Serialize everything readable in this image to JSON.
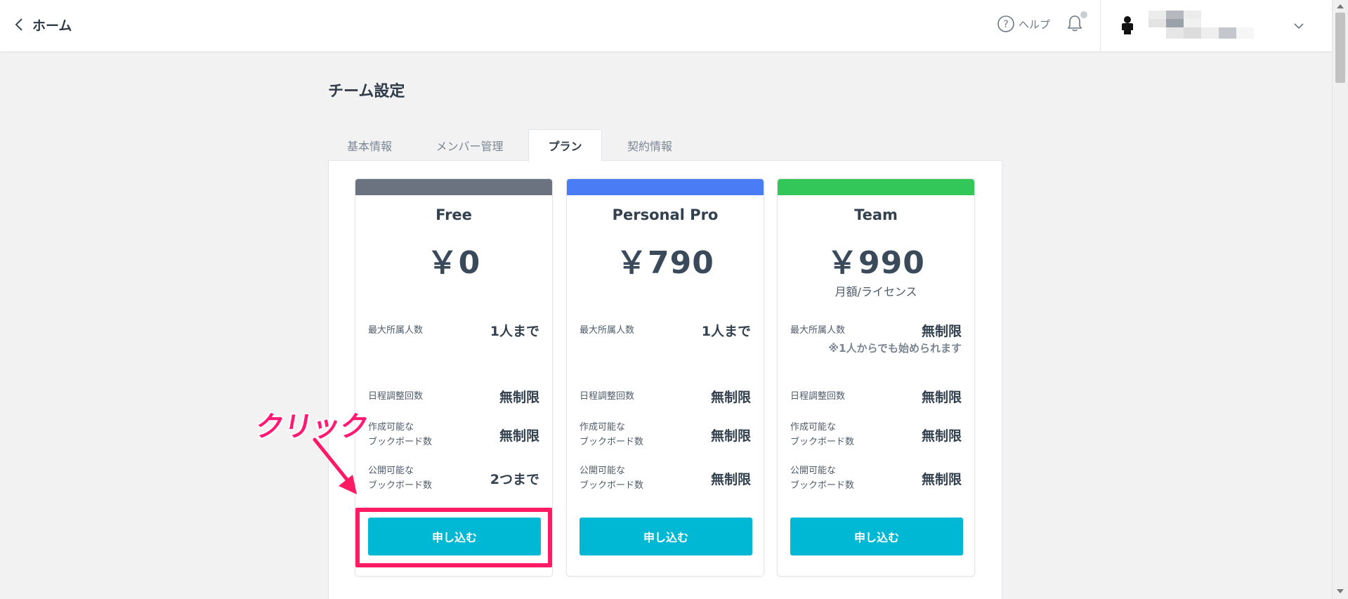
{
  "header": {
    "back_label": "ホーム",
    "help_label": "ヘルプ"
  },
  "page": {
    "title": "チーム設定",
    "tabs": [
      {
        "label": "基本情報",
        "active": false
      },
      {
        "label": "メンバー管理",
        "active": false
      },
      {
        "label": "プラン",
        "active": true
      },
      {
        "label": "契約情報",
        "active": false
      }
    ]
  },
  "plans": [
    {
      "name": "Free",
      "price": "￥0",
      "subprice": "",
      "color": "#6b7280",
      "max_members_label": "最大所属人数",
      "max_members_value": "1人まで",
      "max_members_note": "",
      "schedule_label": "日程調整回数",
      "schedule_value": "無制限",
      "boards_label_1": "作成可能な",
      "boards_label_2": "ブックボード数",
      "boards_value": "無制限",
      "public_label_1": "公開可能な",
      "public_label_2": "ブックボード数",
      "public_value": "2つまで",
      "button_label": "申し込む"
    },
    {
      "name": "Personal Pro",
      "price": "￥790",
      "subprice": "",
      "color": "#4a7cf6",
      "max_members_label": "最大所属人数",
      "max_members_value": "1人まで",
      "max_members_note": "",
      "schedule_label": "日程調整回数",
      "schedule_value": "無制限",
      "boards_label_1": "作成可能な",
      "boards_label_2": "ブックボード数",
      "boards_value": "無制限",
      "public_label_1": "公開可能な",
      "public_label_2": "ブックボード数",
      "public_value": "無制限",
      "button_label": "申し込む"
    },
    {
      "name": "Team",
      "price": "￥990",
      "subprice": "月額/ライセンス",
      "color": "#33c759",
      "max_members_label": "最大所属人数",
      "max_members_value": "無制限",
      "max_members_note": "※1人からでも始められます",
      "schedule_label": "日程調整回数",
      "schedule_value": "無制限",
      "boards_label_1": "作成可能な",
      "boards_label_2": "ブックボード数",
      "boards_value": "無制限",
      "public_label_1": "公開可能な",
      "public_label_2": "ブックボード数",
      "public_value": "無制限",
      "button_label": "申し込む"
    }
  ],
  "annotation": {
    "click_label": "クリック",
    "color": "#ff1a66"
  },
  "colors": {
    "accent_button": "#00b8d4"
  }
}
